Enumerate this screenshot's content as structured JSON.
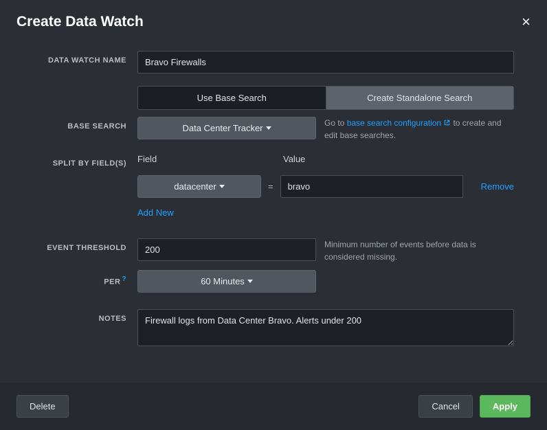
{
  "header": {
    "title": "Create Data Watch"
  },
  "fields": {
    "name_label": "DATA WATCH NAME",
    "name_value": "Bravo Firewalls",
    "search_mode": {
      "use_base": "Use Base Search",
      "standalone": "Create Standalone Search"
    },
    "base_search_label": "BASE SEARCH",
    "base_search_value": "Data Center Tracker",
    "base_search_hint_prefix": "Go to ",
    "base_search_link": "base search configuration",
    "base_search_hint_suffix": " to create and edit base searches.",
    "split_label": "SPLIT BY FIELD(S)",
    "split_field_head": "Field",
    "split_value_head": "Value",
    "split_field": "datacenter",
    "split_value": "bravo",
    "remove": "Remove",
    "add_new": "Add New",
    "threshold_label": "EVENT THRESHOLD",
    "threshold_value": "200",
    "threshold_hint": "Minimum number of events before data is considered missing.",
    "per_label": "PER",
    "per_value": "60 Minutes",
    "notes_label": "NOTES",
    "notes_value": "Firewall logs from Data Center Bravo. Alerts under 200"
  },
  "footer": {
    "delete": "Delete",
    "cancel": "Cancel",
    "apply": "Apply"
  }
}
